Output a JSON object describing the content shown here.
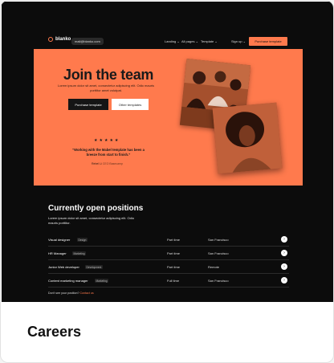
{
  "nav": {
    "brand": "blanko",
    "email": "mail@blanko.com",
    "links": [
      "Landing ⌄",
      "All pages ⌄",
      "Template ⌄",
      "Sign up ⌄"
    ],
    "cta": "Purchase template"
  },
  "hero": {
    "title": "Join the team",
    "subtitle": "Lorem ipsum dolor sit amet, consectetur adipiscing elit. Odio mauris porttitor amet volutpat.",
    "primary_button": "Purchase template",
    "secondary_button": "Other templates",
    "stars": "★★★★★",
    "quote": "“Working with the Mabel template has been a breeze from start to finish.”",
    "author_name": "Rebel Li",
    "author_role": "CEO Basecamp"
  },
  "positions": {
    "heading": "Currently open positions",
    "subtitle": "Lorem ipsum dolor sit amet, consectetur adipiscing elit. Odio mauris porttitor.",
    "rows": [
      {
        "title": "Visual designer",
        "tag": "Design",
        "type": "Part time",
        "location": "San Francisco"
      },
      {
        "title": "HR Manager",
        "tag": "Marketing",
        "type": "Part time",
        "location": "San Francisco"
      },
      {
        "title": "Junior Web developer",
        "tag": "Development",
        "type": "Part time",
        "location": "Remote"
      },
      {
        "title": "Content marketing manager",
        "tag": "Marketing",
        "type": "Full time",
        "location": "San Francisco"
      }
    ],
    "footnote_text": "Don't see your position?",
    "footnote_link": "Contact us"
  },
  "card": {
    "caption": "Careers"
  }
}
